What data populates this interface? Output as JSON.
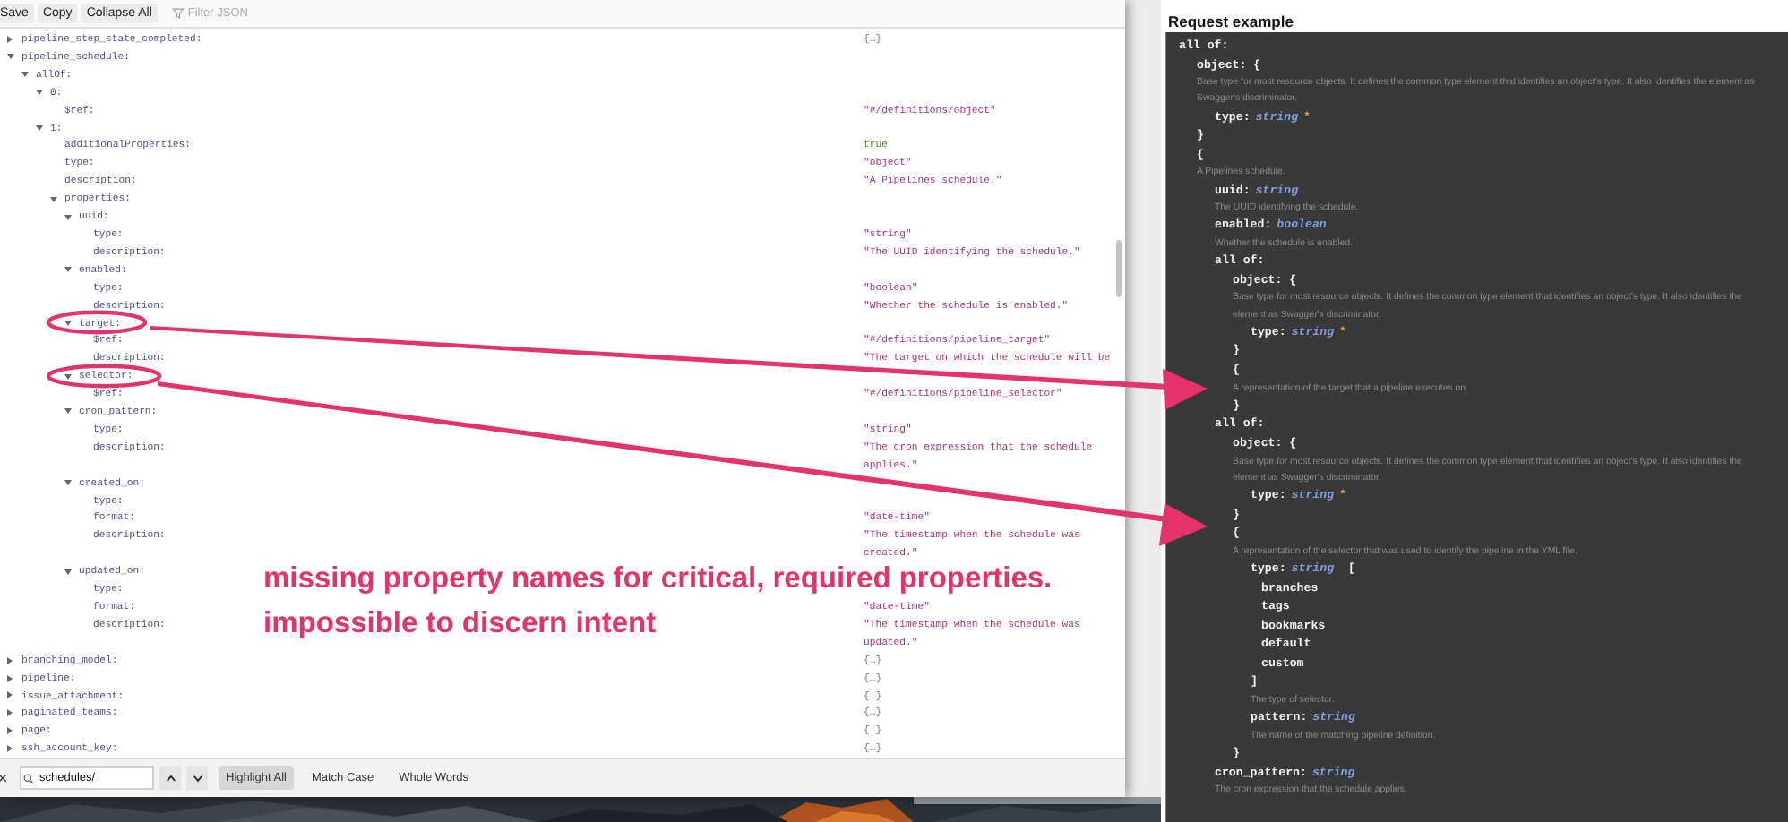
{
  "json_viewer": {
    "toolbar": {
      "buttons": [
        {
          "label": "Save"
        },
        {
          "label": "Copy"
        },
        {
          "label": "Collapse All"
        }
      ],
      "filter": {
        "placeholder": "Filter JSON"
      }
    },
    "tree": [
      {
        "key": "pipeline_step_state_completed:",
        "expanded": false,
        "kind": "object",
        "value": "{…}"
      },
      {
        "key": "pipeline_schedule:",
        "expanded": true,
        "children": [
          {
            "key": "allOf:",
            "expanded": true,
            "children": [
              {
                "key": "0:",
                "expanded": true,
                "children": [
                  {
                    "key": "$ref:",
                    "kind": "string",
                    "value": "\"#/definitions/object\""
                  }
                ]
              },
              {
                "key": "1:",
                "expanded": true,
                "children": [
                  {
                    "key": "additionalProperties:",
                    "kind": "bool",
                    "value": "true"
                  },
                  {
                    "key": "type:",
                    "kind": "string",
                    "value": "\"object\""
                  },
                  {
                    "key": "description:",
                    "kind": "string",
                    "value": "\"A Pipelines schedule.\""
                  },
                  {
                    "key": "properties:",
                    "expanded": true,
                    "children": [
                      {
                        "key": "uuid:",
                        "expanded": true,
                        "children": [
                          {
                            "key": "type:",
                            "kind": "string",
                            "value": "\"string\""
                          },
                          {
                            "key": "description:",
                            "kind": "string",
                            "value": "\"The UUID identifying the schedule.\""
                          }
                        ]
                      },
                      {
                        "key": "enabled:",
                        "expanded": true,
                        "children": [
                          {
                            "key": "type:",
                            "kind": "string",
                            "value": "\"boolean\""
                          },
                          {
                            "key": "description:",
                            "kind": "string",
                            "value": "\"Whether the schedule is enabled.\""
                          }
                        ]
                      },
                      {
                        "key": "target:",
                        "expanded": true,
                        "children": [
                          {
                            "key": "$ref:",
                            "kind": "string",
                            "value": "\"#/definitions/pipeline_target\""
                          },
                          {
                            "key": "description:",
                            "kind": "string",
                            "value": "\"The target on which the schedule will be"
                          }
                        ]
                      },
                      {
                        "key": "selector:",
                        "expanded": true,
                        "children": [
                          {
                            "key": "$ref:",
                            "kind": "string",
                            "value": "\"#/definitions/pipeline_selector\""
                          }
                        ]
                      },
                      {
                        "key": "cron_pattern:",
                        "expanded": true,
                        "children": [
                          {
                            "key": "type:",
                            "kind": "string",
                            "value": "\"string\""
                          },
                          {
                            "key": "description:",
                            "kind": "string",
                            "value": "\"The cron expression that the schedule applies.\""
                          }
                        ]
                      },
                      {
                        "key": "created_on:",
                        "expanded": true,
                        "children": [
                          {
                            "key": "type:"
                          },
                          {
                            "key": "format:",
                            "kind": "string",
                            "value": "\"date-time\""
                          },
                          {
                            "key": "description:",
                            "kind": "string",
                            "value": "\"The timestamp when the schedule was created.\""
                          }
                        ]
                      },
                      {
                        "key": "updated_on:",
                        "expanded": true,
                        "children": [
                          {
                            "key": "type:"
                          },
                          {
                            "key": "format:",
                            "kind": "string",
                            "value": "\"date-time\""
                          },
                          {
                            "key": "description:",
                            "kind": "string",
                            "value": "\"The timestamp when the schedule was updated.\""
                          }
                        ]
                      }
                    ]
                  }
                ]
              }
            ]
          }
        ]
      },
      {
        "key": "branching_model:",
        "expanded": false,
        "kind": "object",
        "value": "{…}"
      },
      {
        "key": "pipeline:",
        "expanded": false,
        "kind": "object",
        "value": "{…}"
      },
      {
        "key": "issue_attachment:",
        "expanded": false,
        "kind": "object",
        "value": "{…}"
      },
      {
        "key": "paginated_teams:",
        "expanded": false,
        "kind": "object",
        "value": "{…}"
      },
      {
        "key": "page:",
        "expanded": false,
        "kind": "object",
        "value": "{…}"
      },
      {
        "key": "ssh_account_key:",
        "expanded": false,
        "kind": "object",
        "value": "{…}"
      }
    ],
    "find_bar": {
      "query": "schedules/",
      "options": [
        {
          "label": "Highlight All",
          "on": true
        },
        {
          "label": "Match Case",
          "on": false
        },
        {
          "label": "Whole Words",
          "on": false
        }
      ]
    }
  },
  "request_example": {
    "title": "Request example",
    "schema": [
      {
        "kind": "allof",
        "label": "all of:",
        "children": [
          {
            "kind": "object",
            "label": "object: {",
            "description": "Base type for most resource objects. It defines the common type element that identifies an object's type. It also identifies the element as Swagger's discriminator.",
            "children": [
              {
                "kind": "prop",
                "name": "type:",
                "type": "string",
                "marker": "*"
              }
            ],
            "close": "}"
          },
          {
            "kind": "object",
            "label": "{",
            "description": "A Pipelines schedule.",
            "children": [
              {
                "kind": "prop",
                "name": "uuid:",
                "type": "string",
                "description": "The UUID identifying the schedule."
              },
              {
                "kind": "prop",
                "name": "enabled:",
                "type": "boolean",
                "description": "Whether the schedule is enabled."
              },
              {
                "kind": "allof",
                "label": "all of:",
                "children": [
                  {
                    "kind": "object",
                    "label": "object: {",
                    "description": "Base type for most resource objects. It defines the common type element that identifies an object's type. It also identifies the element as Swagger's discriminator.",
                    "children": [
                      {
                        "kind": "prop",
                        "name": "type:",
                        "type": "string",
                        "marker": "*"
                      }
                    ],
                    "close": "}"
                  },
                  {
                    "kind": "object",
                    "label": "{",
                    "description": "A representation of the target that a pipeline executes on.",
                    "close": "}"
                  }
                ]
              },
              {
                "kind": "allof",
                "label": "all of:",
                "children": [
                  {
                    "kind": "object",
                    "label": "object: {",
                    "description": "Base type for most resource objects. It defines the common type element that identifies an object's type. It also identifies the element as Swagger's discriminator.",
                    "children": [
                      {
                        "kind": "prop",
                        "name": "type:",
                        "type": "string",
                        "marker": "*"
                      }
                    ],
                    "close": "}"
                  },
                  {
                    "kind": "object",
                    "label": "{",
                    "description": "A representation of the selector that was used to identify the pipeline in the YML file.",
                    "children": [
                      {
                        "kind": "enum",
                        "name": "type:",
                        "type": "string",
                        "open": "[",
                        "options": [
                          "branches",
                          "tags",
                          "bookmarks",
                          "default",
                          "custom"
                        ],
                        "close": "]",
                        "description": "The type of selector."
                      },
                      {
                        "kind": "prop",
                        "name": "pattern:",
                        "type": "string",
                        "description": "The name of the matching pipeline definition."
                      }
                    ],
                    "close": "}"
                  }
                ]
              },
              {
                "kind": "prop",
                "name": "cron_pattern:",
                "type": "string",
                "description": "The cron expression that the schedule applies."
              }
            ]
          }
        ]
      }
    ]
  },
  "annotation": {
    "lines": [
      "missing property names for critical, required properties.",
      "impossible to discern intent"
    ]
  }
}
